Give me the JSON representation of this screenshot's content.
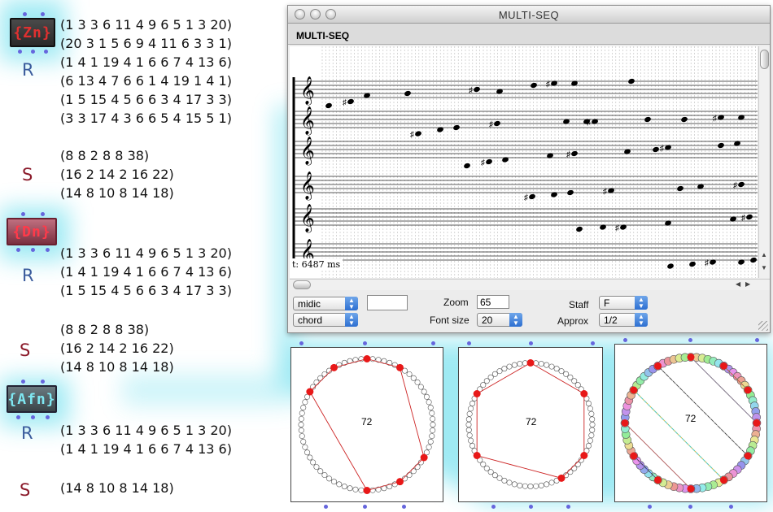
{
  "zn": {
    "label": "{Zn}",
    "r_label": "R",
    "s_label": "S",
    "r_lines": [
      "(1 3 3 6 11 4 9 6 5 1 3 20)",
      "(20 3 1 5 6 9 4 11 6 3 3 1)",
      "(1 4 1 19 4 1 6 6 7 4 13 6)",
      "(6 13 4 7 6 6 1 4 19 1 4 1)",
      "(1 5 15 4 5 6 6 3 4 17 3 3)",
      "(3 3 17 4 3 6 6 5 4 15 5 1)"
    ],
    "s_lines": [
      "(8 8 2 8 8 38)",
      "(16 2 14 2 16 22)",
      "(14 8 10 8 14 18)"
    ]
  },
  "dn": {
    "label": "{Dn}",
    "r_label": "R",
    "s_label": "S",
    "r_lines": [
      "(1 3 3 6 11 4 9 6 5 1 3 20)",
      "(1 4 1 19 4 1 6 6 7 4 13 6)",
      "(1 5 15 4 5 6 6 3 4 17 3 3)"
    ],
    "s_lines": [
      "(8 8 2 8 8 38)",
      "(16 2 14 2 16 22)",
      "(14 8 10 8 14 18)"
    ]
  },
  "afn": {
    "label": "{Afn}",
    "r_label": "R",
    "s_label": "S",
    "r_lines": [
      "(1 3 3 6 11 4 9 6 5 1 3 20)",
      "(1 4 1 19 4 1 6 6 7 4 13 6)"
    ],
    "s_lines": [
      "(14 8 10 8 14 18)"
    ]
  },
  "window": {
    "title": "MULTI-SEQ",
    "header": "MULTI-SEQ",
    "time_label": "t: 6487 ms",
    "controls": {
      "mode_select": "midic",
      "view_select": "chord",
      "zoom_label": "Zoom",
      "zoom_value": "65",
      "fontsize_label": "Font size",
      "fontsize_value": "20",
      "staff_label": "Staff",
      "staff_value": "F",
      "approx_label": "Approx",
      "approx_value": "1/2"
    }
  },
  "circles": [
    {
      "center_label": "72",
      "polygon": [
        0,
        1,
        4,
        5,
        6,
        10,
        11
      ],
      "divisions": 72
    },
    {
      "center_label": "72",
      "polygon": [
        0,
        2,
        4,
        5,
        8,
        10
      ],
      "divisions": 72
    },
    {
      "center_label": "72",
      "polygon": [
        0,
        3,
        7,
        11,
        2,
        6,
        10,
        1,
        5,
        9,
        4,
        8
      ],
      "divisions": 72
    }
  ],
  "colors": {
    "accent": "#1a5fd0",
    "r_label": "#3a5b9c",
    "s_label": "#8b1a2a",
    "circle_marker": "#e81818",
    "glow": "#5cd8ea"
  }
}
